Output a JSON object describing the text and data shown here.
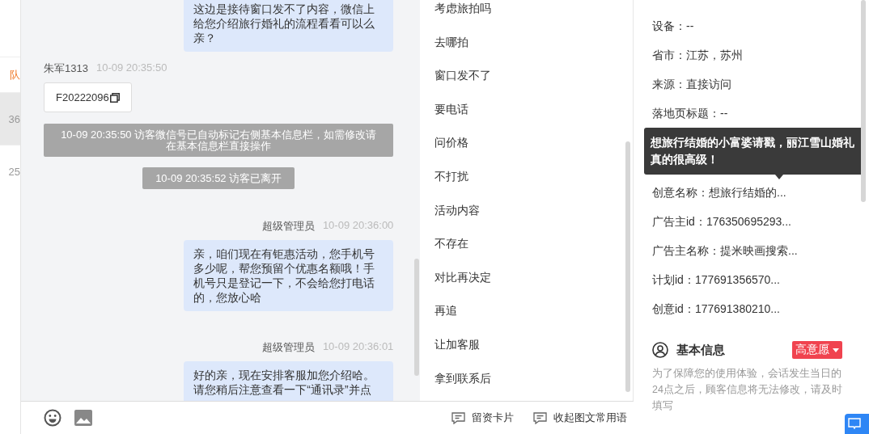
{
  "left_strip": {
    "items": [
      {
        "text": "队",
        "selected": false,
        "kind": "accent"
      },
      {
        "text": "36",
        "selected": true,
        "kind": "plain"
      },
      {
        "text": "25",
        "selected": false,
        "kind": "plain"
      }
    ]
  },
  "messages": [
    {
      "kind": "agent",
      "text": "这边是接待窗口发不了内容，微信上给您介绍旅行婚礼的流程看看可以么亲？"
    },
    {
      "kind": "visitor",
      "sender": "朱军1313",
      "time": "10-09 20:35:50",
      "card": "F20222096"
    },
    {
      "kind": "system",
      "text": "10-09 20:35:50 访客微信号已自动标记右侧基本信息栏，如需修改请在基本信息栏直接操作"
    },
    {
      "kind": "system",
      "text": "10-09 20:35:52 访客已离开"
    },
    {
      "kind": "agent",
      "sender": "超级管理员",
      "time": "10-09 20:36:00",
      "text": "亲，咱们现在有钜惠活动，您手机号多少呢，帮您预留个优惠名额哦！手机号只是登记一下，不会给您打电话的，您放心哈"
    },
    {
      "kind": "agent",
      "sender": "超级管理员",
      "time": "10-09 20:36:01",
      "text": "好的亲，现在安排客服加您介绍哈。请您稍后注意查看一下“通讯录”并点"
    }
  ],
  "quick_replies": [
    "考虑旅拍吗",
    "去哪拍",
    "窗口发不了",
    "要电话",
    "问价格",
    "不打扰",
    "活动内容",
    "不存在",
    "对比再决定",
    "再追",
    "让加客服",
    "拿到联系后"
  ],
  "toolbar": {
    "actions": [
      "留资卡片",
      "收起图文常用语"
    ]
  },
  "visitor_info": {
    "rows": [
      {
        "kind": "field",
        "text": "设备：--"
      },
      {
        "kind": "field",
        "text": "省市：江苏，苏州"
      },
      {
        "kind": "field",
        "text": "来源：直接访问"
      },
      {
        "kind": "field",
        "text": "落地页标题：--"
      },
      {
        "kind": "tooltip",
        "text": "想旅行结婚的小富婆请戳，丽江雪山婚礼真的很高级！"
      },
      {
        "kind": "field",
        "text": "创意名称：想旅行结婚的..."
      },
      {
        "kind": "field",
        "text": "广告主id：176350695293..."
      },
      {
        "kind": "field",
        "text": "广告主名称：提米映画搜索..."
      },
      {
        "kind": "field",
        "text": "计划id：177691356570..."
      },
      {
        "kind": "field",
        "text": "创意id：177691380210..."
      }
    ]
  },
  "basic_info": {
    "title": "基本信息",
    "intent": "高意愿",
    "note": "为了保障您的使用体验，会话发生当日的24点之后，顾客信息将无法修改，请及时填写"
  }
}
